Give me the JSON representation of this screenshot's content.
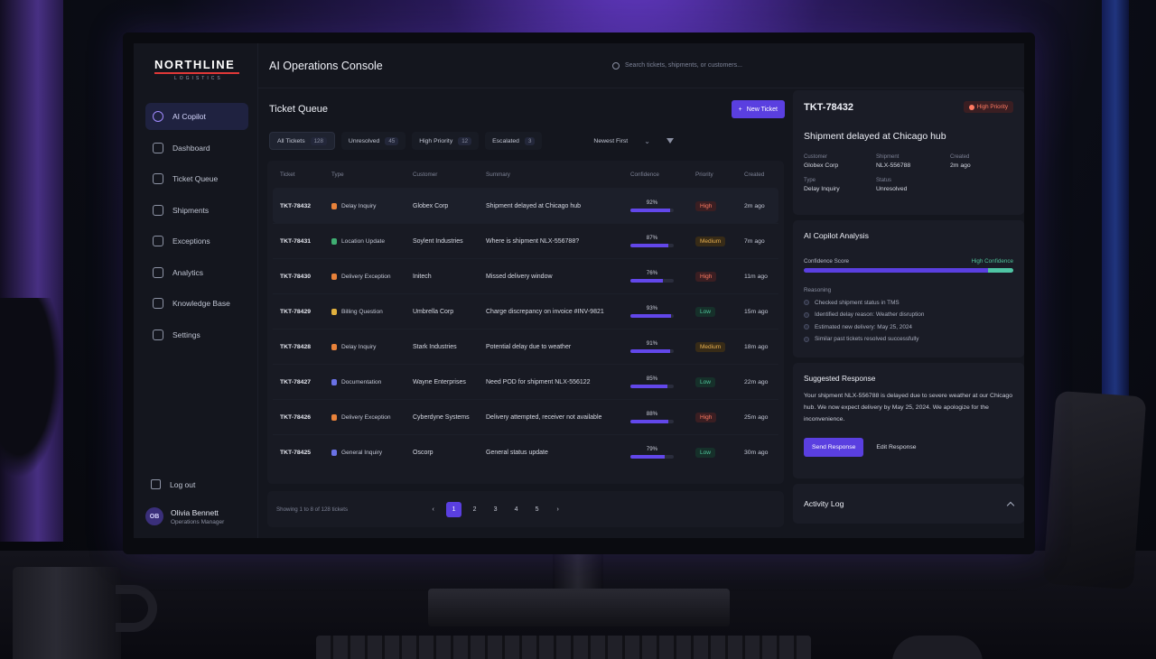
{
  "brand": {
    "name": "NORTHLINE",
    "sub": "LOGISTICS"
  },
  "app_title": "AI Operations Console",
  "search": {
    "placeholder": "Search tickets, shipments, or customers..."
  },
  "nav": [
    {
      "label": "AI Copilot",
      "icon": "sparkle-icon",
      "active": true
    },
    {
      "label": "Dashboard",
      "icon": "dashboard-icon"
    },
    {
      "label": "Ticket Queue",
      "icon": "ticket-icon"
    },
    {
      "label": "Shipments",
      "icon": "box-icon"
    },
    {
      "label": "Exceptions",
      "icon": "alert-icon"
    },
    {
      "label": "Analytics",
      "icon": "chart-icon"
    },
    {
      "label": "Knowledge Base",
      "icon": "book-icon"
    },
    {
      "label": "Settings",
      "icon": "gear-icon"
    }
  ],
  "logout_label": "Log out",
  "user": {
    "initials": "OB",
    "name": "Olivia Bennett",
    "role": "Operations Manager"
  },
  "queue": {
    "title": "Ticket Queue",
    "new_ticket_label": "New Ticket",
    "filters": [
      {
        "label": "All Tickets",
        "count": "128",
        "active": true
      },
      {
        "label": "Unresolved",
        "count": "45"
      },
      {
        "label": "High Priority",
        "count": "12"
      },
      {
        "label": "Escalated",
        "count": "3"
      }
    ],
    "sort_label": "Newest First",
    "columns": [
      "Ticket",
      "Type",
      "Customer",
      "Summary",
      "Confidence",
      "Priority",
      "Created"
    ],
    "rows": [
      {
        "id": "TKT-78432",
        "type": "Delay Inquiry",
        "type_color": "#e8823a",
        "customer": "Globex Corp",
        "summary": "Shipment delayed at Chicago hub",
        "confidence": "92%",
        "confidence_value": 0.92,
        "priority": "High",
        "created": "2m ago"
      },
      {
        "id": "TKT-78431",
        "type": "Location Update",
        "type_color": "#3fae72",
        "customer": "Soylent Industries",
        "summary": "Where is shipment NLX-556788?",
        "confidence": "87%",
        "confidence_value": 0.87,
        "priority": "Medium",
        "created": "7m ago"
      },
      {
        "id": "TKT-78430",
        "type": "Delivery Exception",
        "type_color": "#e8823a",
        "customer": "Initech",
        "summary": "Missed delivery window",
        "confidence": "76%",
        "confidence_value": 0.76,
        "priority": "High",
        "created": "11m ago"
      },
      {
        "id": "TKT-78429",
        "type": "Billing Question",
        "type_color": "#e0b03e",
        "customer": "Umbrella Corp",
        "summary": "Charge discrepancy on invoice #INV-9821",
        "confidence": "93%",
        "confidence_value": 0.93,
        "priority": "Low",
        "created": "15m ago"
      },
      {
        "id": "TKT-78428",
        "type": "Delay Inquiry",
        "type_color": "#e8823a",
        "customer": "Stark Industries",
        "summary": "Potential delay due to weather",
        "confidence": "91%",
        "confidence_value": 0.91,
        "priority": "Medium",
        "created": "18m ago"
      },
      {
        "id": "TKT-78427",
        "type": "Documentation",
        "type_color": "#6a72e6",
        "customer": "Wayne Enterprises",
        "summary": "Need POD for shipment NLX-556122",
        "confidence": "85%",
        "confidence_value": 0.85,
        "priority": "Low",
        "created": "22m ago"
      },
      {
        "id": "TKT-78426",
        "type": "Delivery Exception",
        "type_color": "#e8823a",
        "customer": "Cyberdyne Systems",
        "summary": "Delivery attempted, receiver not available",
        "confidence": "88%",
        "confidence_value": 0.88,
        "priority": "High",
        "created": "25m ago"
      },
      {
        "id": "TKT-78425",
        "type": "General Inquiry",
        "type_color": "#6a72e6",
        "customer": "Oscorp",
        "summary": "General status update",
        "confidence": "79%",
        "confidence_value": 0.79,
        "priority": "Low",
        "created": "30m ago"
      }
    ],
    "pager_text": "Showing 1 to 8 of 128 tickets",
    "pages": [
      "1",
      "2",
      "3",
      "4",
      "5"
    ],
    "current_page": "1"
  },
  "detail": {
    "id": "TKT-78432",
    "badge": "High Priority",
    "title": "Shipment delayed at Chicago hub",
    "fields": [
      {
        "label": "Customer",
        "value": "Globex Corp"
      },
      {
        "label": "Shipment",
        "value": "NLX-556788"
      },
      {
        "label": "Created",
        "value": "2m ago"
      },
      {
        "label": "Type",
        "value": "Delay Inquiry"
      },
      {
        "label": "Status",
        "value": "Unresolved"
      }
    ]
  },
  "analysis": {
    "title": "AI Copilot Analysis",
    "score_label": "Confidence Score",
    "score_tag": "High Confidence",
    "score_value": 0.88,
    "reasoning_label": "Reasoning",
    "reasons": [
      "Checked shipment status in TMS",
      "Identified delay reason: Weather disruption",
      "Estimated new delivery: May 25, 2024",
      "Similar past tickets resolved successfully"
    ]
  },
  "suggested": {
    "title": "Suggested Response",
    "text": "Your shipment NLX-556788 is delayed due to severe weather at our Chicago hub. We now expect delivery by May 25, 2024. We apologize for the inconvenience.",
    "send_label": "Send Response",
    "edit_label": "Edit Response"
  },
  "activity_title": "Activity Log"
}
